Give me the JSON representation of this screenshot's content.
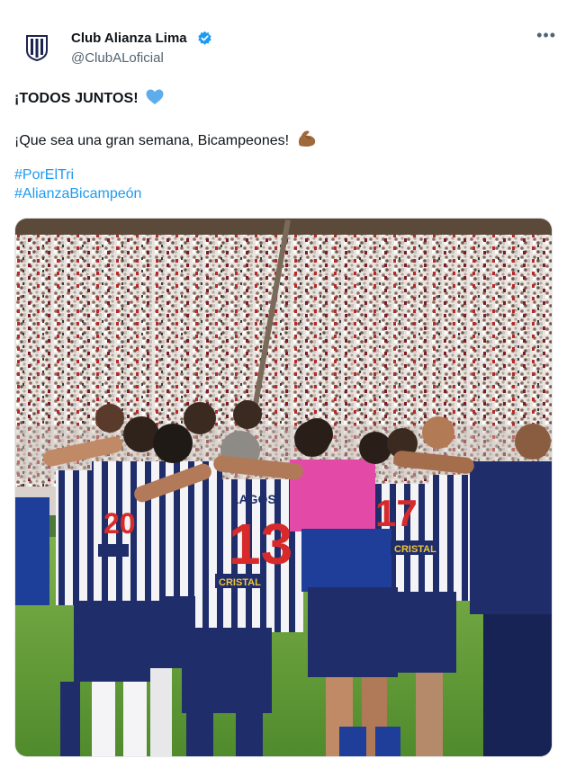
{
  "author": {
    "display_name": "Club Alianza Lima",
    "handle": "@ClubALoficial",
    "verified": true
  },
  "tweet": {
    "line1": "¡TODOS JUNTOS!",
    "line1_emoji": "blue-heart-icon",
    "line2": "¡Que sea una gran semana, Bicampeones!",
    "line2_emoji": "flexed-biceps-icon",
    "hashtags": [
      "#PorElTri",
      "#AlianzaBicampeón"
    ]
  },
  "media": {
    "description_icon": "photo",
    "jersey_numbers": [
      "13",
      "17",
      "20"
    ],
    "jersey_name": "LAGOS",
    "sponsor": "CRISTAL"
  },
  "colors": {
    "accent": "#1d9bf0",
    "text": "#0f1419",
    "secondary": "#536471",
    "kit_navy": "#1f2e6b",
    "keeper_pink": "#e34aa8"
  }
}
